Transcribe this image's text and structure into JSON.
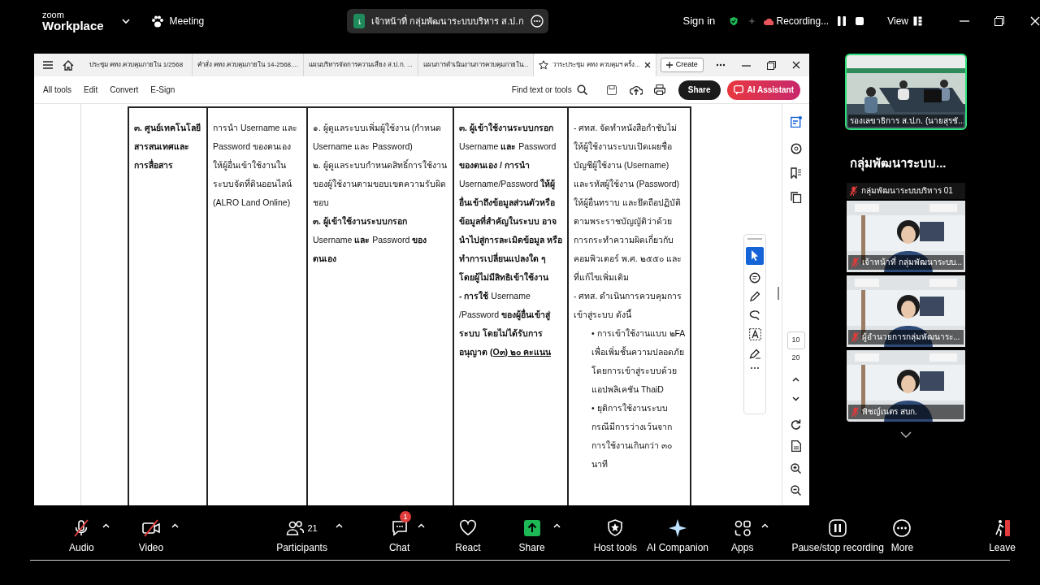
{
  "zoom_bar": {
    "brand_top": "zoom",
    "brand": "Workplace",
    "menu": "Meeting",
    "meeting_title": "เจ้าหน้าที่ กลุ่มพัฒนาระบบบริหาร ส.ป.ก",
    "avatar_letter": "เ",
    "sign_in": "Sign in",
    "recording": "Recording...",
    "view": "View"
  },
  "browser": {
    "tabs": [
      {
        "label": "ประชุม คทง.ควบคุมภายใน 1/2568",
        "selected": false
      },
      {
        "label": "คำสั่ง คทง.ควบคุมภายใน 14-2568....",
        "selected": false
      },
      {
        "label": "แผนบริหารจัดการความเสี่ยง ส.ป.ก. ...",
        "selected": false
      },
      {
        "label": "แผนการดำเนินงานการควบคุมภายใน...",
        "selected": false
      },
      {
        "label": "วาระประชุม คทง ควบคุมฯ ครั้ง...",
        "selected": true
      }
    ],
    "create": "Create",
    "menus": [
      "All tools",
      "Edit",
      "Convert",
      "E-Sign"
    ],
    "find": "Find text or tools",
    "share": "Share",
    "ai": "AI Assistant"
  },
  "document": {
    "cells": [
      {
        "bold": true,
        "paragraphs": [
          {
            "kind": "plain",
            "text": "๓. ศูนย์เทคโนโลยีสารสนเทศและการสื่อสาร"
          }
        ]
      },
      {
        "bold": false,
        "paragraphs": [
          {
            "kind": "plain",
            "text": "การนำ Username และ Password ของตนเอง ให้ผู้อื่นเข้าใช้งานในระบบจัดที่ดินออนไลน์ (ALRO Land Online)"
          }
        ]
      },
      {
        "bold": false,
        "paragraphs": [
          {
            "kind": "plain",
            "text": "๑. ผู้ดูแลระบบเพิ่มผู้ใช้งาน (กำหนด Username และ Password)"
          },
          {
            "kind": "plain",
            "text": "๒. ผู้ดูแลระบบกำหนดสิทธิ์การใช้งานของผู้ใช้งานตามขอบเขตความรับผิดชอบ"
          },
          {
            "kind": "plain",
            "text": "**๓. ผู้เข้าใช้งานระบบกรอก** Username **และ** Password **ของตนเอง**"
          }
        ]
      },
      {
        "bold": false,
        "paragraphs": [
          {
            "kind": "plain",
            "text": "**๓. ผู้เข้าใช้งานระบบกรอก** Username **และ** Password **ของตนเอง / การนำ** Username/Password **ให้ผู้อื่นเข้าถึงข้อมูลส่วนตัวหรือข้อมูลที่สำคัญในระบบ อาจนำไปสู่การละเมิดข้อมูล หรือ ทำการเปลี่ยนแปลงใด ๆ โดยผู้ไม่มีสิทธิเข้าใช้งาน**"
          },
          {
            "kind": "plain",
            "text": "**- การใช้** Username /Password **ของผู้อื่นเข้าสู่ระบบ โดยไม่ได้รับการอนุญาต**",
            "note": "(O๓) ๒๐ คะแนน"
          }
        ]
      },
      {
        "bold": false,
        "paragraphs": [
          {
            "kind": "plain",
            "text": "- ศทส. จัดทำหนังสือกำชับไม่ให้ผู้ใช้งานระบบเปิดเผยชื่อบัญชีผู้ใช้งาน (Username) และรหัสผู้ใช้งาน (Password) ให้ผู้อื่นทราบ และยึดถือปฏิบัติตามพระราชบัญญัติว่าด้วยการกระทำความผิดเกี่ยวกับคอมพิวเตอร์ พ.ศ. ๒๕๕๐ และที่แก้ไขเพิ่มเติม"
          },
          {
            "kind": "plain",
            "text": "- ศทส. ดำเนินการควบคุมการเข้าสู่ระบบ ดังนี้"
          },
          {
            "kind": "bullet",
            "text": "• การเข้าใช้งานแบบ ๒FA เพื่อเพิ่มชั้นความปลอดภัยโดยการเข้าสู่ระบบด้วยแอปพลิเคชัน ThaiD"
          },
          {
            "kind": "bullet",
            "text": "• ยุติการใช้งานระบบกรณีมีการว่างเว้นจากการใช้งานเกินกว่า ๓๐ นาที"
          }
        ]
      }
    ]
  },
  "page_rail": {
    "pages": [
      "10",
      "20"
    ]
  },
  "gallery": {
    "top_tile": {
      "label": "รองเลขาธิการ ส.ป.ก. (นายสุรชั...",
      "selected": true
    },
    "group_heading": "กลุ่มพัฒนาระบบ...",
    "group_label": {
      "label": "กลุ่มพัฒนาระบบบริหาร 01",
      "muted": true
    },
    "tiles": [
      {
        "label": "เจ้าหน้าที่ กลุ่มพัฒนาระบบ...",
        "muted": true,
        "selected": false
      },
      {
        "label": "ผู้อำนวยการกลุ่มพัฒนาระ...",
        "muted": true,
        "selected": false
      },
      {
        "label": "พิชญ์เนตร สบก.",
        "muted": true,
        "selected": false
      }
    ]
  },
  "controls": [
    {
      "kind": "audio",
      "label": "Audio",
      "crossed": true,
      "caret": true
    },
    {
      "kind": "video",
      "label": "Video",
      "crossed": true,
      "caret": true
    },
    {
      "kind": "participants",
      "label": "Participants",
      "count": "21",
      "crossed": false,
      "caret": true
    },
    {
      "kind": "chat",
      "label": "Chat",
      "badge": "1",
      "crossed": false,
      "caret": true
    },
    {
      "kind": "react",
      "label": "React",
      "crossed": false,
      "caret": false
    },
    {
      "kind": "share",
      "label": "Share",
      "crossed": false,
      "caret": true
    },
    {
      "kind": "host",
      "label": "Host tools",
      "crossed": false,
      "caret": false
    },
    {
      "kind": "ai",
      "label": "AI Companion",
      "crossed": false,
      "caret": false
    },
    {
      "kind": "apps",
      "label": "Apps",
      "crossed": false,
      "caret": true
    },
    {
      "kind": "record",
      "label": "Pause/stop recording",
      "crossed": false,
      "caret": false
    },
    {
      "kind": "more",
      "label": "More",
      "crossed": false,
      "caret": false
    },
    {
      "kind": "leave",
      "label": "Leave",
      "crossed": false,
      "caret": false
    }
  ]
}
